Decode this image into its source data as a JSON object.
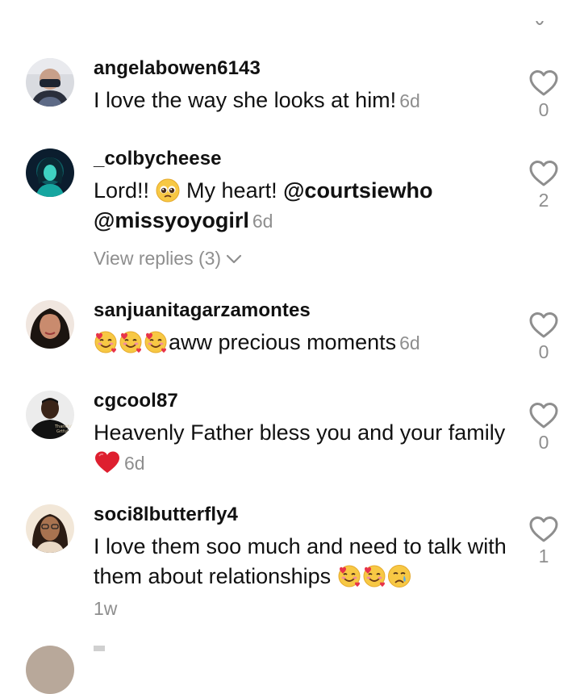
{
  "comments": [
    {
      "username": "angelabowen6143",
      "text": "I love the way she looks at him!",
      "time": "6d",
      "likes": "0",
      "avatar_icon": "user-avatar-masked"
    },
    {
      "username": "_colbycheese",
      "text_before": "Lord!! ",
      "emoji": "pleading-face",
      "text_middle": " My heart! ",
      "mention1": "@courtsiewho",
      "mention2": "@missyoyogirl",
      "time": "6d",
      "replies_label": "View replies (3)",
      "likes": "2",
      "avatar_icon": "user-avatar-teal"
    },
    {
      "username": "sanjuanitagarzamontes",
      "emojis": [
        "smiling-face-with-hearts",
        "smiling-face-with-hearts",
        "smiling-face-with-hearts"
      ],
      "text": "aww precious moments",
      "time": "6d",
      "likes": "0",
      "avatar_icon": "user-avatar-woman"
    },
    {
      "username": "cgcool87",
      "text": "Heavenly Father bless you and your family",
      "emoji": "red-heart",
      "time": "6d",
      "likes": "0",
      "avatar_icon": "user-avatar-man"
    },
    {
      "username": "soci8lbutterfly4",
      "text": "I love them soo much and need to talk with them about relationships",
      "emojis": [
        "smiling-face-with-hearts",
        "smiling-face-with-hearts",
        "crying-face"
      ],
      "time": "1w",
      "likes": "1",
      "avatar_icon": "user-avatar-woman-glasses"
    }
  ],
  "colors": {
    "text": "#111111",
    "secondary": "#8e8e8e",
    "background": "#ffffff"
  }
}
